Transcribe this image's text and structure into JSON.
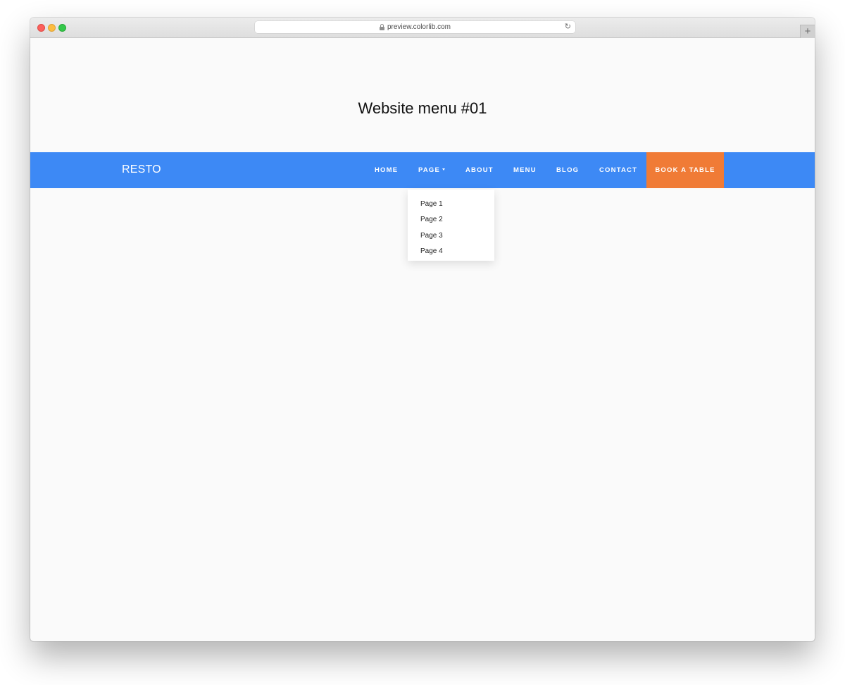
{
  "browser": {
    "url": "preview.colorlib.com",
    "lock_icon": "lock-icon",
    "reload_icon": "reload-icon",
    "reload_glyph": "↻",
    "new_tab_glyph": "+",
    "traffic_colors": {
      "close": "#fc605c",
      "minimize": "#fcbc40",
      "zoom": "#34c84a"
    }
  },
  "page": {
    "title": "Website menu #01"
  },
  "navbar": {
    "background": "#3d89f5",
    "brand": "RESTO",
    "items": [
      {
        "label": "HOME"
      },
      {
        "label": "PAGE"
      },
      {
        "label": "ABOUT"
      },
      {
        "label": "MENU"
      },
      {
        "label": "BLOG"
      },
      {
        "label": "CONTACT"
      }
    ],
    "cta": {
      "label": "BOOK A TABLE",
      "color": "#f07b36"
    }
  },
  "dropdown": {
    "open_under": "PAGE",
    "items": [
      {
        "label": "Page 1"
      },
      {
        "label": "Page 2"
      },
      {
        "label": "Page 3"
      },
      {
        "label": "Page 4"
      }
    ]
  }
}
